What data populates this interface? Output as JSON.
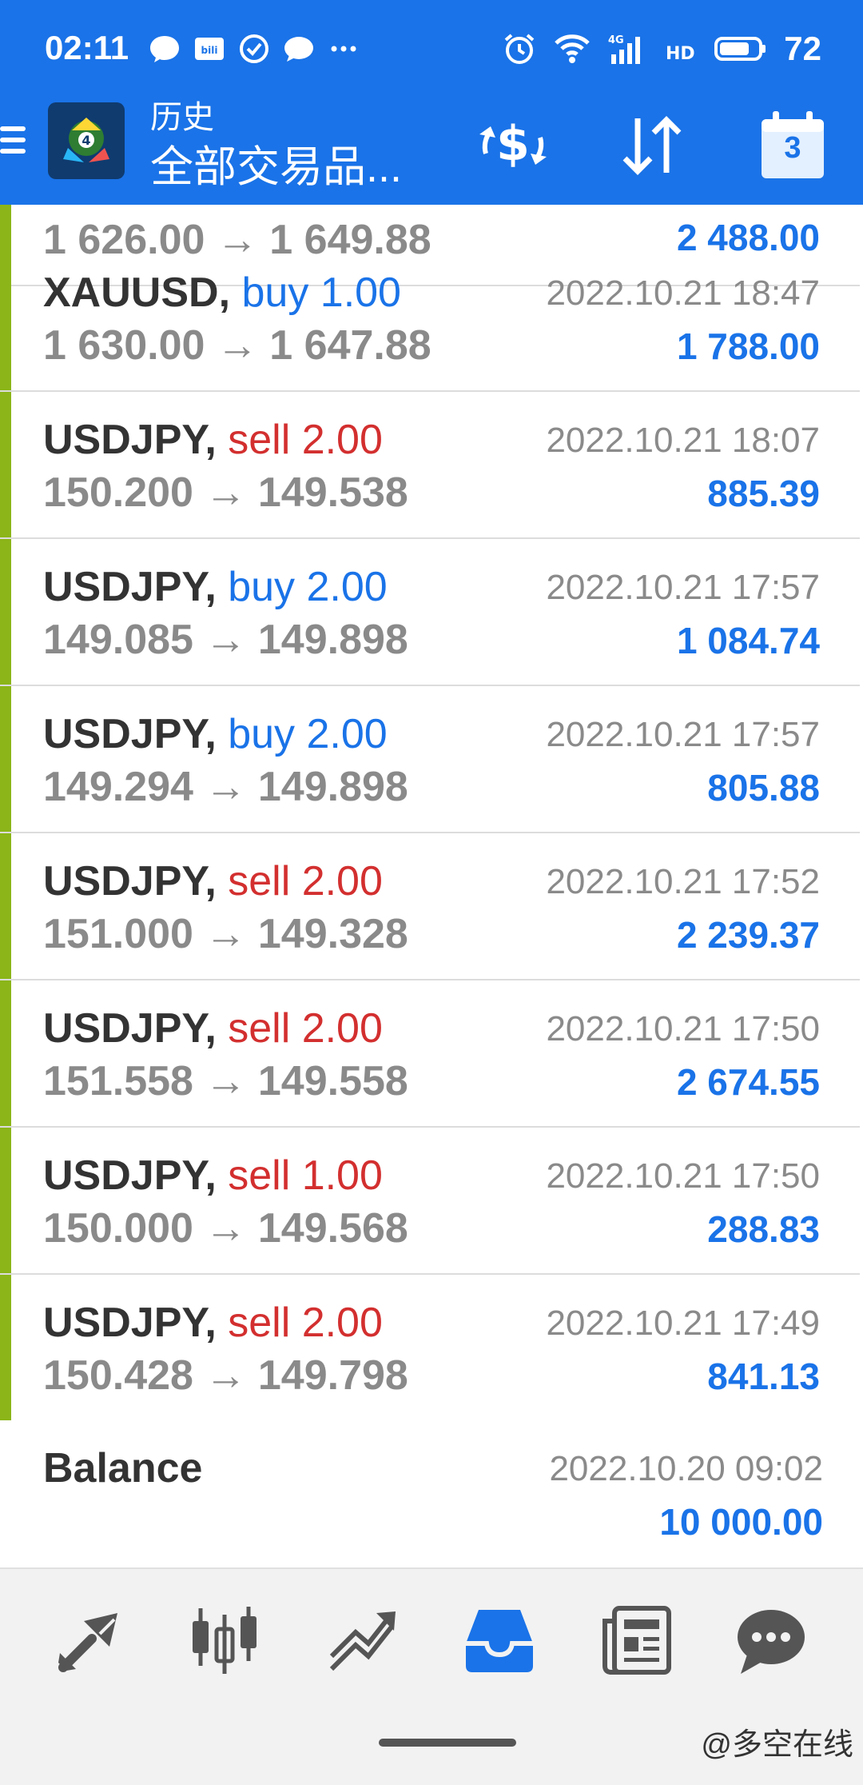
{
  "status_bar": {
    "time": "02:11",
    "battery": "72",
    "icons_left": [
      "message-bubble-icon",
      "bilibili-icon",
      "check-circle-icon",
      "chat-icon",
      "more-dots-icon"
    ],
    "icons_right": [
      "alarm-icon",
      "wifi-icon",
      "signal-4g-icon",
      "hd-icon",
      "battery-icon"
    ]
  },
  "toolbar": {
    "title_top": "历史",
    "title_main": "全部交易品...",
    "calendar_day": "3"
  },
  "colors": {
    "accent": "#1a73e8",
    "buy": "#1a73e8",
    "sell": "#d32f2f",
    "profit_bar": "#8bb519"
  },
  "partial_row": {
    "prices": "1 626.00 → 1 649.88",
    "profit": "2 488.00"
  },
  "trades": [
    {
      "symbol": "XAUUSD,",
      "side": "buy",
      "volume": "buy 1.00",
      "prices": "1 630.00 → 1 647.88",
      "time": "2022.10.21 18:47",
      "profit": "1 788.00"
    },
    {
      "symbol": "USDJPY,",
      "side": "sell",
      "volume": "sell 2.00",
      "prices": "150.200 → 149.538",
      "time": "2022.10.21 18:07",
      "profit": "885.39"
    },
    {
      "symbol": "USDJPY,",
      "side": "buy",
      "volume": "buy 2.00",
      "prices": "149.085 → 149.898",
      "time": "2022.10.21 17:57",
      "profit": "1 084.74"
    },
    {
      "symbol": "USDJPY,",
      "side": "buy",
      "volume": "buy 2.00",
      "prices": "149.294 → 149.898",
      "time": "2022.10.21 17:57",
      "profit": "805.88"
    },
    {
      "symbol": "USDJPY,",
      "side": "sell",
      "volume": "sell 2.00",
      "prices": "151.000 → 149.328",
      "time": "2022.10.21 17:52",
      "profit": "2 239.37"
    },
    {
      "symbol": "USDJPY,",
      "side": "sell",
      "volume": "sell 2.00",
      "prices": "151.558 → 149.558",
      "time": "2022.10.21 17:50",
      "profit": "2 674.55"
    },
    {
      "symbol": "USDJPY,",
      "side": "sell",
      "volume": "sell 1.00",
      "prices": "150.000 → 149.568",
      "time": "2022.10.21 17:50",
      "profit": "288.83"
    },
    {
      "symbol": "USDJPY,",
      "side": "sell",
      "volume": "sell 2.00",
      "prices": "150.428 → 149.798",
      "time": "2022.10.21 17:49",
      "profit": "841.13"
    }
  ],
  "balance": {
    "label": "Balance",
    "time": "2022.10.20 09:02",
    "amount": "10 000.00"
  },
  "bottom_nav": {
    "items": [
      "quotes",
      "chart",
      "trade",
      "history",
      "news",
      "chat"
    ],
    "active": "history"
  },
  "watermark": "@多空在线"
}
